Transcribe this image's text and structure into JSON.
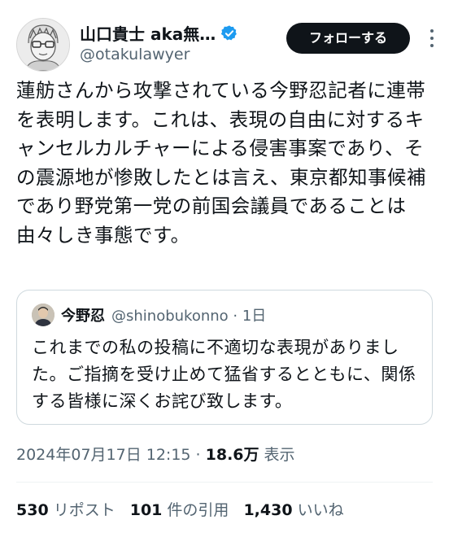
{
  "author": {
    "display_name": "山口貴士 aka無…",
    "handle": "@otakulawyer",
    "avatar_icon": "avatar-illustration"
  },
  "follow_label": "フォローする",
  "tweet_text": "蓮舫さんから攻撃されている今野忍記者に連帯を表明します。これは、表現の自由に対するキャンセルカルチャーによる侵害事案であり、その震源地が惨敗したとは言え、東京都知事候補であり野党第一党の前国会議員であることは由々しき事態です。",
  "quoted": {
    "name": "今野忍",
    "handle_time": "@shinobukonno · 1日",
    "text": "これまでの私の投稿に不適切な表現がありました。ご指摘を受け止めて猛省するとともに、関係する皆様に深くお詫び致します。"
  },
  "meta": {
    "datetime": "2024年07月17日 12:15 · ",
    "views": "18.6万",
    "views_label": " 表示"
  },
  "stats": {
    "reposts_count": "530",
    "reposts_label": " リポスト",
    "quotes_count": "101",
    "quotes_label": " 件の引用",
    "likes_count": "1,430",
    "likes_label": " いいね"
  },
  "colors": {
    "text": "#0f1419",
    "secondary": "#536471",
    "verified": "#1d9bf0",
    "border": "#cfd9de"
  }
}
